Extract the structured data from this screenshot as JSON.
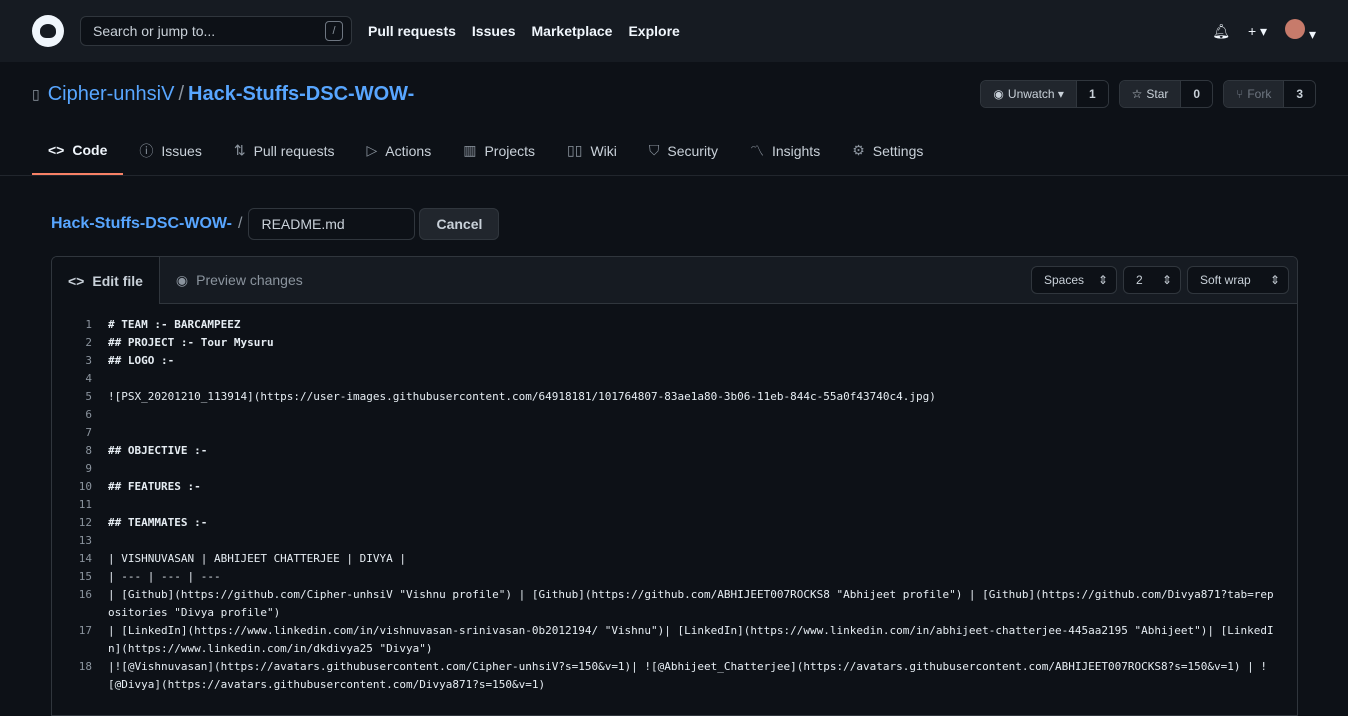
{
  "header": {
    "search_placeholder": "Search or jump to...",
    "slash": "/",
    "nav": [
      "Pull requests",
      "Issues",
      "Marketplace",
      "Explore"
    ],
    "plus": "+ ▾"
  },
  "repo": {
    "owner": "Cipher-unhsiV",
    "sep": "/",
    "name": "Hack-Stuffs-DSC-WOW-",
    "unwatch": "Unwatch",
    "watch_count": "1",
    "star": "Star",
    "star_count": "0",
    "fork": "Fork",
    "fork_count": "3"
  },
  "tabs": [
    "Code",
    "Issues",
    "Pull requests",
    "Actions",
    "Projects",
    "Wiki",
    "Security",
    "Insights",
    "Settings"
  ],
  "crumb": {
    "repo": "Hack-Stuffs-DSC-WOW-",
    "sep": "/",
    "filename": "README.md",
    "cancel": "Cancel"
  },
  "editor": {
    "edit_tab": "Edit file",
    "preview_tab": "Preview changes",
    "indent_mode": "Spaces",
    "indent_size": "2",
    "wrap_mode": "Soft wrap",
    "lines": [
      "# TEAM :- BARCAMPEEZ",
      "## PROJECT :- Tour Mysuru",
      "## LOGO :-",
      "",
      "![PSX_20201210_113914](https://user-images.githubusercontent.com/64918181/101764807-83ae1a80-3b06-11eb-844c-55a0f43740c4.jpg)",
      "",
      "",
      "## OBJECTIVE :-",
      "",
      "## FEATURES :-",
      "",
      "## TEAMMATES :-",
      "",
      "| VISHNUVASAN | ABHIJEET CHATTERJEE | DIVYA |",
      "| --- | --- | ---",
      "| [Github](https://github.com/Cipher-unhsiV \"Vishnu profile\") | [Github](https://github.com/ABHIJEET007ROCKS8 \"Abhijeet profile\") | [Github](https://github.com/Divya871?tab=repositories \"Divya profile\")",
      "| [LinkedIn](https://www.linkedin.com/in/vishnuvasan-srinivasan-0b2012194/ \"Vishnu\")| [LinkedIn](https://www.linkedin.com/in/abhijeet-chatterjee-445aa2195 \"Abhijeet\")| [LinkedIn](https://www.linkedin.com/in/dkdivya25 \"Divya\")",
      "|![@Vishnuvasan](https://avatars.githubusercontent.com/Cipher-unhsiV?s=150&v=1)| ![@Abhijeet_Chatterjee](https://avatars.githubusercontent.com/ABHIJEET007ROCKS8?s=150&v=1) | ![@Divya](https://avatars.githubusercontent.com/Divya871?s=150&v=1)"
    ]
  }
}
